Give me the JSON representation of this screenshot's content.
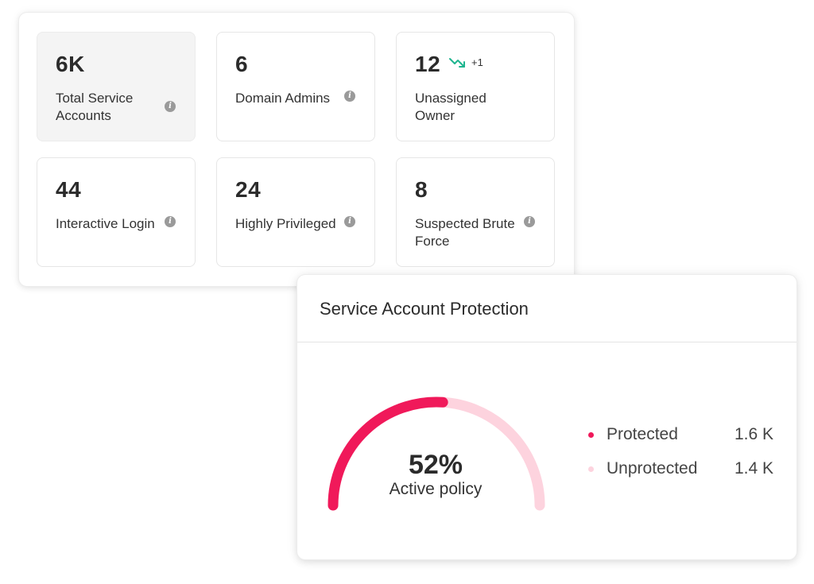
{
  "stats": [
    {
      "value": "6K",
      "label": "Total Service Accounts",
      "info": true,
      "selected": true
    },
    {
      "value": "6",
      "label": "Domain Admins",
      "info": true
    },
    {
      "value": "12",
      "label": "Unassigned Owner",
      "info": false,
      "trend": {
        "icon": "trend-down-icon",
        "delta": "+1",
        "color": "#1fb58f"
      }
    },
    {
      "value": "44",
      "label": "Interactive Login",
      "info": true
    },
    {
      "value": "24",
      "label": "Highly Privileged",
      "info": true
    },
    {
      "value": "8",
      "label": "Suspected Brute Force",
      "info": true
    }
  ],
  "protection": {
    "title": "Service Account Protection",
    "gauge": {
      "percent": 52,
      "value_text": "52%",
      "caption": "Active policy",
      "filled_color": "#f0195a",
      "track_color": "#fdd3de"
    },
    "legend": [
      {
        "name": "Protected",
        "value": "1.6 K",
        "color": "#f0195a"
      },
      {
        "name": "Unprotected",
        "value": "1.4 K",
        "color": "#fdd3de"
      }
    ]
  }
}
